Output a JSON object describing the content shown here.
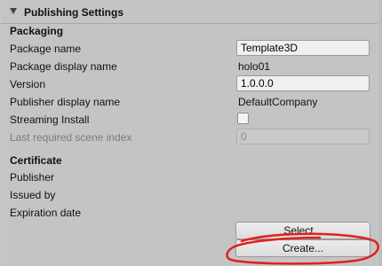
{
  "header": {
    "title": "Publishing Settings"
  },
  "packaging": {
    "section_title": "Packaging",
    "package_name_label": "Package name",
    "package_name_value": "Template3D",
    "package_display_name_label": "Package display name",
    "package_display_name_value": "holo01",
    "version_label": "Version",
    "version_value": "1.0.0.0",
    "publisher_display_name_label": "Publisher display name",
    "publisher_display_name_value": "DefaultCompany",
    "streaming_install_label": "Streaming Install",
    "streaming_install_checked": false,
    "last_scene_index_label": "Last required scene index",
    "last_scene_index_value": "0"
  },
  "certificate": {
    "section_title": "Certificate",
    "publisher_label": "Publisher",
    "issued_by_label": "Issued by",
    "expiration_label": "Expiration date",
    "select_button": "Select...",
    "create_button": "Create..."
  },
  "colors": {
    "annotation": "#e02020",
    "panel_bg": "#c4c4c4"
  }
}
